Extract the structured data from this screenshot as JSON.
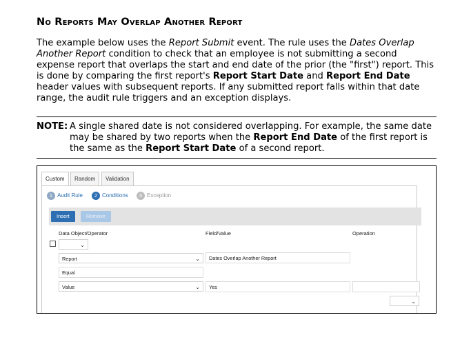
{
  "doc": {
    "heading": "No Reports May Overlap Another Report",
    "para": {
      "p1": "The example below uses the ",
      "event": "Report Submit",
      "p2": " event. The rule uses the ",
      "cond": "Dates Overlap Another Report",
      "p3": " condition to check that an employee is not submitting a second expense report that overlaps the start and end date of the prior (the \"first\") report. This is done by comparing the first report's ",
      "b1": "Report Start Date",
      "p4": " and ",
      "b2": "Report End Date",
      "p5": " header values with subsequent reports. If any submitted report falls within that date range, the audit rule triggers and an exception displays."
    },
    "note": {
      "label": "NOTE:",
      "t1": "A single shared date is not considered overlapping. For example, the same date may be shared by two reports when the ",
      "b1": "Report End Date",
      "t2": " of the first report is the same as the ",
      "b2": "Report Start Date",
      "t3": " of a second report."
    }
  },
  "ui": {
    "tabs": [
      "Custom",
      "Random",
      "Validation"
    ],
    "steps": [
      {
        "num": "1",
        "label": "Audit Rule",
        "color": "#8fa9c4"
      },
      {
        "num": "2",
        "label": "Conditions",
        "color": "#2d6fb2"
      },
      {
        "num": "3",
        "label": "Exception",
        "color": "#bdbdbd"
      }
    ],
    "toolbar": {
      "insert": "Insert",
      "remove": "Remove"
    },
    "columns": {
      "data_object": "Data Object/Operator",
      "field_value": "Field/Value",
      "operation": "Operation"
    },
    "row": {
      "data_object_select": "",
      "report_select": "Report",
      "field_value": "Dates Overlap Another Report",
      "operator": "Equal",
      "value_select": "Value",
      "value_input": "Yes",
      "operation_select": ""
    }
  }
}
